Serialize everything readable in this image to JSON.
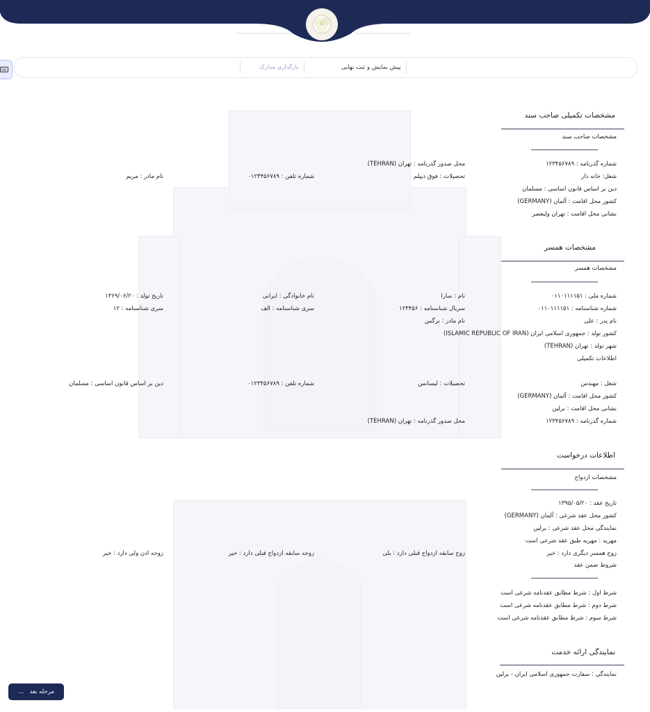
{
  "header": {
    "logo_icon": "flower-logo-icon",
    "accent": "#1c2a55"
  },
  "tabs": [
    {
      "label": "پیش نمایش و ثبت نهایی"
    },
    {
      "label": "بارگذاری مدارک"
    }
  ],
  "keyboard_icon": "keyboard-icon",
  "owner": {
    "title": "مشخصات تکمیلی صاحب سند",
    "subtitle": "مشخصات صاحب سند",
    "passport_no": "شماره گذرنامه : ۱۲۳۴۵۶۷۸۹",
    "passport_place": "محل صدور گذرنامه : تهران (TEHRAN)",
    "job": "شغل: خانه دار",
    "education": "تحصیلات : فوق دیپلم",
    "phone": "شماره تلفن : ۰۱۲۳۴۵۶۷۸۹",
    "mother": "نام مادر : مریم",
    "religion": "دین بر اساس قانون اساسی : مسلمان",
    "residence_country": "کشور محل اقامت : آلمان (GERMANY)",
    "address": "نشانی محل اقامت : تهران ولیعصر"
  },
  "spouse": {
    "title": "مشخصات همسر",
    "subtitle": "مشخصات همسر",
    "national_id": "شماره ملی : ۰۱۱۰۱۱۱۱۵۱",
    "first_name": "نام : سارا",
    "last_name": "نام خانوادگی : ایرانی",
    "birth_date": "تاریخ تولد : ۱۳۶۹/۰۶/۲۰",
    "id_no": "شماره شناسنامه : ۰۱۱۰۱۱۱۱۵۱",
    "serial": "سریال شناسنامه : ۱۲۳۴۵۶",
    "series": "سری شناسنامه : الف",
    "series_no": "سری شناسنامه : ۱۲",
    "father": "نام پدر : علی",
    "mother": "نام مادر : نرگس",
    "birth_country": "کشور تولد : جمهوری اسلامی ایران (ISLAMIC REPUBLIC OF IRAN)",
    "birth_city": "شهر تولد : تهران (TEHRAN)",
    "extra_title": "اطلاعات تکمیلی",
    "job": "شغل : مهندس",
    "education": "تحصیلات : لیسانس",
    "phone": "شماره تلفن : ۰۱۲۳۴۵۶۷۸۹",
    "religion": "دین بر اساس قانون اساسی : مسلمان",
    "residence_country": "کشور محل اقامت : آلمان (GERMANY)",
    "address": "نشانی محل اقامت : برلین",
    "passport_no": "شماره گذرنامه : ۱۲۳۴۵۶۷۸۹",
    "passport_place": "محل صدور گذرنامه : تهران (TEHRAN)"
  },
  "request": {
    "title": "اطلاعات درخواست",
    "subtitle": "مشخصات ازدواج",
    "contract_date": "تاریخ عقد : ۱۳۹۵/۰۵/۲۰",
    "contract_country": "کشور محل عقد شرعی : آلمان (GERMANY)",
    "contract_rep": "نمایندگی محل عقد شرعی : برلین",
    "mahr": "مهریه : مهریه طبق عقد شرعی است",
    "husband_other_wife": "زوج همسر دیگری دارد : خیر",
    "husband_prev_marriage": "زوج سابقه ازدواج قبلی دارد : بلی",
    "wife_prev_marriage": "زوجه سابقه ازدواج قبلی دارد : خیر",
    "wife_guardian": "زوجه اذن ولی دارد : خیر",
    "conditions_title": "شروط ضمن عقد",
    "cond1": "شرط اول : شرط مطابق عقدنامه شرعی است",
    "cond2": "شرط دوم : شرط مطابق عقدنامه شرعی است",
    "cond3": "شرط سوم : شرط مطابق عقدنامه شرعی است"
  },
  "service": {
    "title": "نمایندگی ارائه خدمت",
    "rep": "نمایندگی : سفارت جمهوری اسلامی ایران - برلین"
  },
  "footer": {
    "next_label": "مرحله بعد",
    "next_icon": "ellipsis-icon"
  }
}
